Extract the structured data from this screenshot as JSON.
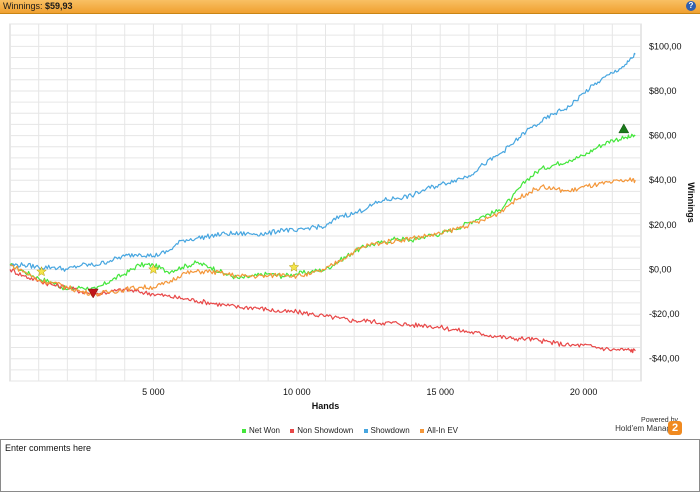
{
  "header": {
    "label": "Winnings:",
    "value": "$59,93",
    "help_glyph": "?"
  },
  "chart_data": {
    "type": "line",
    "xlabel": "Hands",
    "ylabel": "Winnings",
    "xlim": [
      0,
      22000
    ],
    "ylim": [
      -50,
      110
    ],
    "x_ticks": [
      5000,
      10000,
      15000,
      20000
    ],
    "x_tick_labels": [
      "5 000",
      "10 000",
      "15 000",
      "20 000"
    ],
    "y_ticks": [
      -40,
      -20,
      0,
      20,
      40,
      60,
      80,
      100
    ],
    "y_tick_labels": [
      "-$40,00",
      "-$20,00",
      "$0,00",
      "$20,00",
      "$40,00",
      "$60,00",
      "$80,00",
      "$100,00"
    ],
    "grid": true,
    "legend_placement": "bottom",
    "x": [
      0,
      500,
      1000,
      1500,
      2000,
      2500,
      3000,
      3500,
      4000,
      4500,
      5000,
      5500,
      6000,
      6500,
      7000,
      7500,
      8000,
      8500,
      9000,
      9500,
      10000,
      10500,
      11000,
      11500,
      12000,
      12500,
      13000,
      13500,
      14000,
      14500,
      15000,
      15500,
      16000,
      16500,
      17000,
      17500,
      18000,
      18500,
      19000,
      19500,
      20000,
      20500,
      21000,
      21500,
      21800
    ],
    "series": [
      {
        "name": "Net Won",
        "color": "#44e63c",
        "values": [
          2,
          -1,
          -4,
          -6,
          -9,
          -8,
          -9,
          -5,
          -2,
          2,
          2,
          -1,
          1,
          3,
          1,
          -2,
          -4,
          -3,
          -2,
          -3,
          -2,
          -1,
          0,
          4,
          8,
          11,
          12,
          14,
          13,
          15,
          16,
          18,
          21,
          24,
          26,
          32,
          40,
          45,
          47,
          49,
          51,
          55,
          58,
          59,
          59.9
        ]
      },
      {
        "name": "Non Showdown",
        "color": "#e84848",
        "values": [
          0,
          -3,
          -5,
          -7,
          -8,
          -10,
          -11,
          -10,
          -9,
          -10,
          -11,
          -12,
          -13,
          -14,
          -15,
          -16,
          -17,
          -17,
          -18,
          -19,
          -19,
          -20,
          -21,
          -22,
          -23,
          -23,
          -24,
          -24,
          -25,
          -25,
          -26,
          -27,
          -28,
          -29,
          -30,
          -31,
          -31,
          -32,
          -33,
          -34,
          -34,
          -35,
          -36,
          -36,
          -36.5
        ]
      },
      {
        "name": "Showdown",
        "color": "#47a6e0",
        "values": [
          2,
          2,
          1,
          1,
          0,
          2,
          2,
          4,
          6,
          7,
          6,
          8,
          13,
          14,
          15,
          16,
          16,
          16,
          16,
          18,
          17,
          19,
          19,
          24,
          25,
          28,
          31,
          32,
          33,
          36,
          38,
          40,
          42,
          47,
          51,
          56,
          62,
          66,
          70,
          73,
          79,
          84,
          88,
          92,
          96.4
        ]
      },
      {
        "name": "All-In EV",
        "color": "#f4973a",
        "values": [
          2,
          -1,
          -5,
          -6,
          -8,
          -10,
          -11,
          -10,
          -9,
          -8,
          -8,
          -6,
          -2,
          -1,
          -1,
          -2,
          -3,
          -3,
          -3,
          -2,
          -3,
          -2,
          0,
          4,
          8,
          11,
          12,
          13,
          14,
          15,
          16,
          18,
          20,
          22,
          25,
          30,
          34,
          37,
          36,
          35,
          37,
          38,
          39,
          40,
          40
        ]
      }
    ],
    "markers": [
      {
        "type": "triangle-down",
        "color": "#c0141a",
        "x": 2900,
        "y": -11
      },
      {
        "type": "triangle-up",
        "color": "#1a7a1a",
        "x": 21400,
        "y": 63
      },
      {
        "type": "star",
        "color": "#f4e44a",
        "x": 1100,
        "y": -1
      },
      {
        "type": "star",
        "color": "#f4e44a",
        "x": 5000,
        "y": 0
      },
      {
        "type": "star",
        "color": "#f4e44a",
        "x": 9900,
        "y": 1
      }
    ]
  },
  "legend": {
    "items": [
      {
        "label": "Net Won",
        "color": "#44e63c"
      },
      {
        "label": "Non Showdown",
        "color": "#e84848"
      },
      {
        "label": "Showdown",
        "color": "#47a6e0"
      },
      {
        "label": "All-In EV",
        "color": "#f4973a"
      }
    ]
  },
  "branding": {
    "powered_by": "Powered by",
    "product": "Hold'em Manager",
    "version_badge": "2"
  },
  "comments": {
    "placeholder": "Enter comments here"
  }
}
